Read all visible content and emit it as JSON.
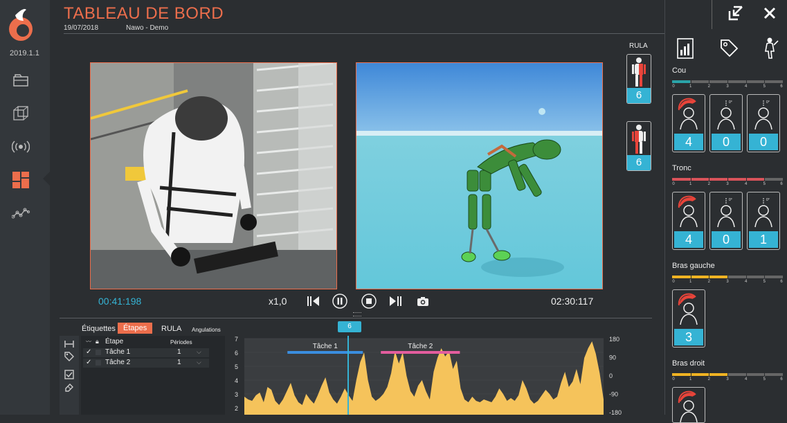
{
  "app": {
    "version": "2019.1.1",
    "title": "TABLEAU DE BORD",
    "date": "19/07/2018",
    "project": "Nawo - Demo"
  },
  "sidebar": {
    "items": [
      {
        "name": "folder-icon"
      },
      {
        "name": "cube-icon"
      },
      {
        "name": "broadcast-icon"
      },
      {
        "name": "dashboard-icon",
        "active": true
      },
      {
        "name": "graph-icon"
      }
    ]
  },
  "player": {
    "current_time": "00:41:198",
    "speed": "x1,0",
    "total_time": "02:30:117",
    "controls": [
      "step-back-icon",
      "pause-icon",
      "stop-icon",
      "step-forward-icon",
      "camera-icon"
    ]
  },
  "rula": {
    "label": "RULA",
    "left_score": "6",
    "right_score": "6"
  },
  "right_panel": {
    "tabs": [
      "report-icon",
      "tag-icon",
      "posture-icon"
    ],
    "scale_labels": [
      "0",
      "1",
      "2",
      "3",
      "4",
      "5",
      "6"
    ],
    "sections": [
      {
        "label": "Cou",
        "fill": 0.16,
        "color": "#2aa3a8",
        "values": [
          "4",
          "0",
          "0"
        ]
      },
      {
        "label": "Tronc",
        "fill": 0.83,
        "color": "#d9535a",
        "values": [
          "4",
          "0",
          "1"
        ]
      },
      {
        "label": "Bras gauche",
        "fill": 0.5,
        "color": "#f0b323",
        "values": [
          "3"
        ]
      },
      {
        "label": "Bras droit",
        "fill": 0.5,
        "color": "#f0b323",
        "values": []
      }
    ],
    "icon_captions": {
      "neck_ext": "In extension",
      "trunk_twist": "Front bending",
      "arm_range": "45° - 90°"
    }
  },
  "bottom": {
    "tabs": [
      "Étiquettes",
      "Étapes",
      "RULA",
      "Angulations"
    ],
    "active_tab": "Étapes",
    "marker": "6",
    "list_header": {
      "name": "Étape",
      "periods": "Périodes"
    },
    "rows": [
      {
        "name": "Tâche 1",
        "periods": "1"
      },
      {
        "name": "Tâche 2",
        "periods": "1"
      }
    ]
  },
  "chart_data": {
    "type": "area",
    "yleft_ticks": [
      "7",
      "6",
      "5",
      "4",
      "3",
      "2"
    ],
    "yright_ticks": [
      "180",
      "90",
      "0",
      "-90",
      "-180"
    ],
    "ylim": [
      1.5,
      7
    ],
    "cursor_value": "6",
    "segments": [
      {
        "name": "Tâche 1",
        "start": 0.12,
        "end": 0.33,
        "color": "#3a8ee0"
      },
      {
        "name": "Tâche 2",
        "start": 0.38,
        "end": 0.6,
        "color": "#e35d9e"
      }
    ],
    "series_color": "#f5c35b",
    "series": [
      2.8,
      2.6,
      2.5,
      2.9,
      3.1,
      2.4,
      3.5,
      3.3,
      2.5,
      2.2,
      2.6,
      3.2,
      3.8,
      2.9,
      2.4,
      2.2,
      3.0,
      2.6,
      2.3,
      2.9,
      3.6,
      4.2,
      3.1,
      2.6,
      2.3,
      2.8,
      3.4,
      2.9,
      2.5,
      4.0,
      5.3,
      6.0,
      4.0,
      2.8,
      2.5,
      2.7,
      3.0,
      3.5,
      4.5,
      6.1,
      5.2,
      6.0,
      4.3,
      3.2,
      2.8,
      3.6,
      4.0,
      3.2,
      2.6,
      4.6,
      5.6,
      6.3,
      5.7,
      6.1,
      4.8,
      5.4,
      3.4,
      2.6,
      2.4,
      2.8,
      2.5,
      2.4,
      2.6,
      2.5,
      2.4,
      2.8,
      3.4,
      3.0,
      2.5,
      2.7,
      2.5,
      2.9,
      4.0,
      3.4,
      2.6,
      2.3,
      2.5,
      2.9,
      3.3,
      3.0,
      2.6,
      2.8,
      3.8,
      4.6,
      3.5,
      3.9,
      4.8,
      3.7,
      5.6,
      6.3,
      6.8,
      5.9,
      4.5,
      2.6
    ]
  }
}
